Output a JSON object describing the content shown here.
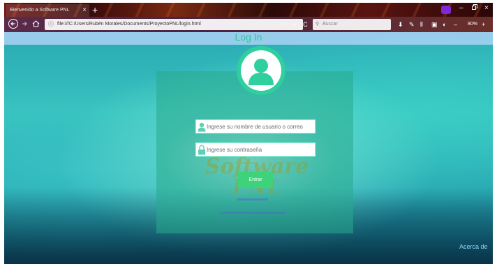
{
  "browser": {
    "tab_title": "Bienvenido a Software PNL",
    "tab_close": "×",
    "new_tab": "+",
    "url": "file:///C:/Users/Rubén Morales/Documents/ProyectoPNL/login.html",
    "url_more": "···",
    "search_placeholder": "Buscar",
    "zoom": "80%",
    "window_minimize": "–",
    "window_close": "×"
  },
  "page": {
    "title": "Log In",
    "username_placeholder": "Ingrese su nombre de usuario o correo",
    "password_placeholder": "Ingrese su contraseña",
    "enter_label": "Entrar",
    "watermark_line1": "Software",
    "watermark_line2": "PNL",
    "about_label": "Acerca de"
  },
  "colors": {
    "accent_green": "#2fcf9e",
    "button_green": "#3ed27a",
    "link_blue": "#4a6fc7"
  }
}
